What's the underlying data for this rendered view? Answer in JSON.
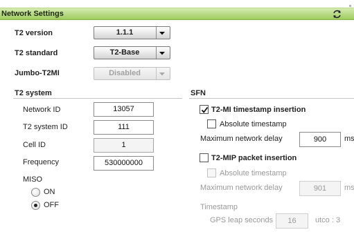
{
  "window": {
    "title": "Network Settings",
    "refresh_icon": "refresh-icon"
  },
  "colors": {
    "title_bar": "#9ecb5e",
    "title_bar_light": "#d5ebb1"
  },
  "t2_version": {
    "label": "T2 version",
    "value": "1.1.1"
  },
  "t2_standard": {
    "label": "T2 standard",
    "value": "T2-Base"
  },
  "jumbo_t2mi": {
    "label": "Jumbo-T2MI",
    "value": "Disabled",
    "disabled": true
  },
  "t2_system": {
    "heading": "T2 system",
    "network_id": {
      "label": "Network ID",
      "value": "13057"
    },
    "t2_system_id": {
      "label": "T2 system ID",
      "value": "111"
    },
    "cell_id": {
      "label": "Cell ID",
      "value": "1"
    },
    "frequency": {
      "label": "Frequency",
      "value": "530000000"
    },
    "miso": {
      "label": "MISO",
      "options": [
        {
          "label": "ON",
          "selected": false
        },
        {
          "label": "OFF",
          "selected": true
        }
      ]
    }
  },
  "sfn": {
    "heading": "SFN",
    "t2mi_timestamp": {
      "label": "T2-MI timestamp insertion",
      "checked": true,
      "absolute_label": "Absolute timestamp",
      "absolute_checked": false,
      "max_delay_label": "Maximum network delay",
      "max_delay_value": "900",
      "unit": "ms"
    },
    "t2mip_packet": {
      "label": "T2-MIP packet insertion",
      "checked": false,
      "absolute_label": "Absolute timestamp",
      "absolute_checked": false,
      "max_delay_label": "Maximum network delay",
      "max_delay_value": "901",
      "unit": "ms"
    },
    "timestamp": {
      "label": "Timestamp",
      "gps_leap_label": "GPS leap seconds",
      "gps_leap_value": "16",
      "utco_label": "utco : 3"
    }
  }
}
